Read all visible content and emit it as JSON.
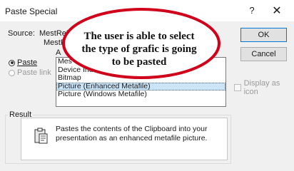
{
  "dialog": {
    "title": "Paste Special",
    "help_label": "?",
    "close_label": "✕",
    "source_label": "Source:",
    "source_value_line1": "MestReN",
    "source_value_line2": "MestRe",
    "as_label": "A",
    "paste_label": "Paste",
    "paste_link_label": "Paste link",
    "paste_checked": true,
    "list_items": [
      "Mes",
      "Device Ind",
      "Bitmap",
      "Picture (Enhanced Metafile)",
      "Picture (Windows Metafile)"
    ],
    "selected_index": 3,
    "ok_label": "OK",
    "cancel_label": "Cancel",
    "display_as_icon_label": "Display as icon",
    "result_label": "Result",
    "result_text": "Pastes the contents of the Clipboard into your presentation as an enhanced metafile picture."
  },
  "annotation": {
    "text": "The user is able to select the type of grafic is going to be pasted",
    "line1": "The user is able to select",
    "line2": "the type of grafic is going",
    "line3": "to be pasted",
    "border_color": "#d0021b",
    "fill_color": "#ffffff"
  },
  "colors": {
    "dialog_bg": "#f0f0f0",
    "selection": "#cce4f7",
    "ok_border": "#0078d7"
  },
  "icons": {
    "clipboard": "clipboard-icon",
    "help": "help-icon",
    "close": "close-icon"
  }
}
